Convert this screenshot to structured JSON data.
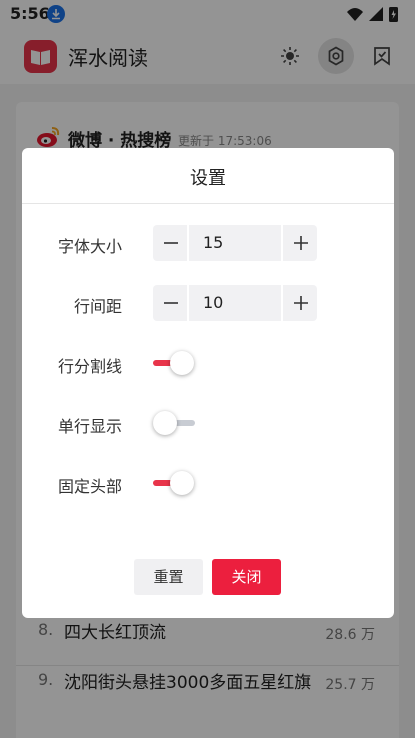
{
  "status_bar": {
    "time": "5:56"
  },
  "app": {
    "title": "浑水阅读",
    "brand_color": "#e8344a"
  },
  "card": {
    "title": "微博 · 热搜榜",
    "updated": "更新于 17:53:06",
    "items": [
      {
        "rank": "8.",
        "title": "四大长红顶流",
        "count": "28.6 万"
      },
      {
        "rank": "9.",
        "title": "沈阳街头悬挂3000多面五星红旗",
        "count": "25.7 万"
      }
    ]
  },
  "dialog": {
    "title": "设置",
    "font_size": {
      "label": "字体大小",
      "value": "15"
    },
    "line_spacing": {
      "label": "行间距",
      "value": "10"
    },
    "row_divider": {
      "label": "行分割线",
      "enabled": true
    },
    "single_line": {
      "label": "单行显示",
      "enabled": false
    },
    "fixed_header": {
      "label": "固定头部",
      "enabled": true
    },
    "reset_label": "重置",
    "close_label": "关闭",
    "accent_color": "#ec1f3e"
  }
}
